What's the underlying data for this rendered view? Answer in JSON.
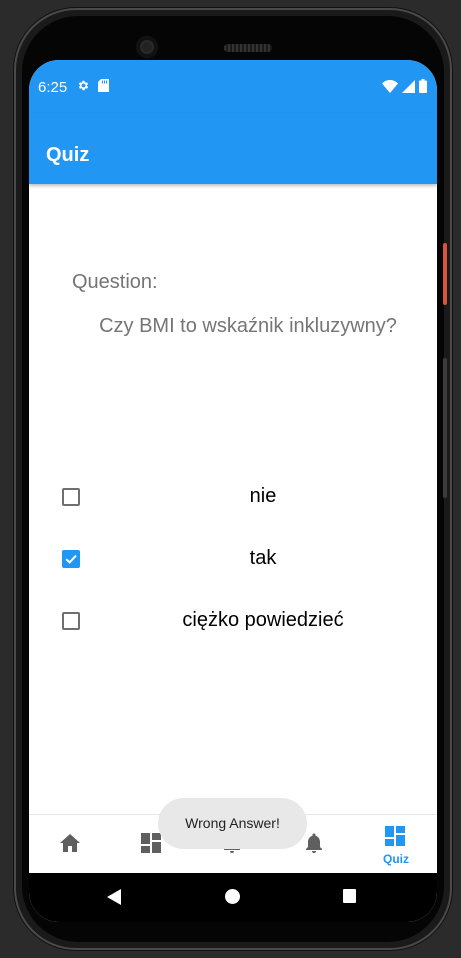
{
  "status": {
    "time": "6:25",
    "left_icons": [
      "gear-icon",
      "sd-card-icon"
    ],
    "right_icons": [
      "wifi-icon",
      "signal-icon",
      "battery-icon"
    ]
  },
  "appbar": {
    "title": "Quiz"
  },
  "question": {
    "label": "Question:",
    "text": "Czy BMI to wskaźnik inkluzywny?"
  },
  "answers": [
    {
      "label": "nie",
      "checked": false
    },
    {
      "label": "tak",
      "checked": true
    },
    {
      "label": "ciężko powiedzieć",
      "checked": false
    }
  ],
  "toast": {
    "message": "Wrong Answer!"
  },
  "bottom_nav": {
    "items": [
      {
        "icon": "home-icon",
        "label": ""
      },
      {
        "icon": "dashboard-icon",
        "label": ""
      },
      {
        "icon": "notifications-icon",
        "label": ""
      },
      {
        "icon": "notifications-icon",
        "label": ""
      },
      {
        "icon": "dashboard-icon",
        "label": "Quiz",
        "active": true
      }
    ]
  },
  "colors": {
    "primary": "#2196f3",
    "inactive_icon": "#5f5f5f",
    "question_text": "#757575"
  }
}
